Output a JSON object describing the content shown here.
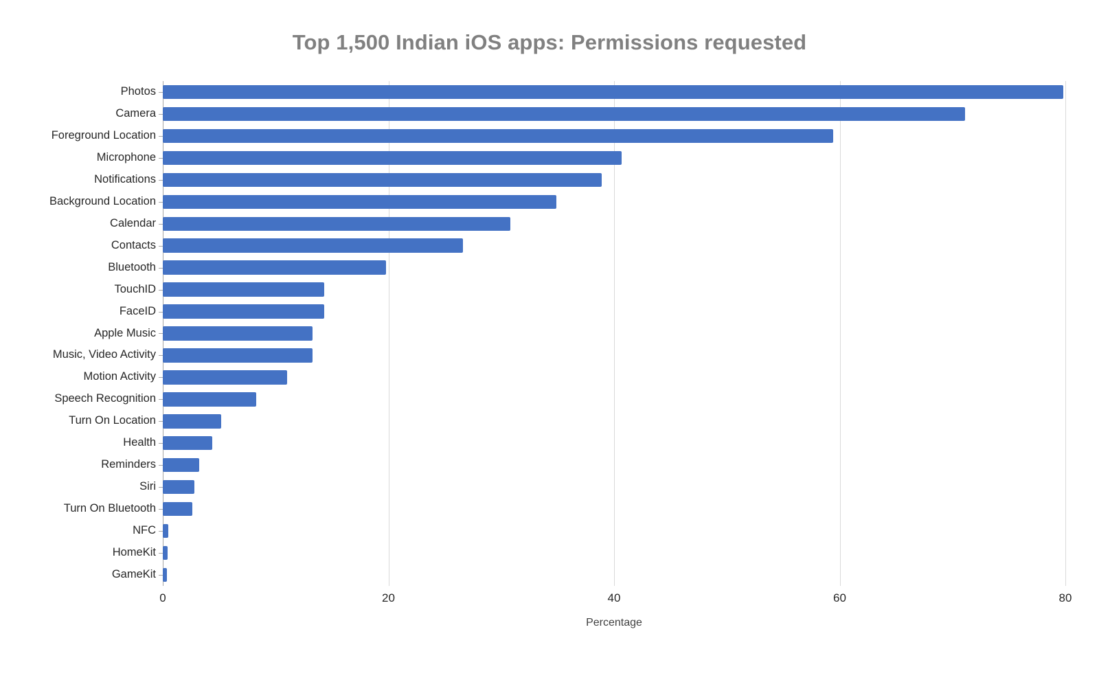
{
  "chart_data": {
    "type": "bar",
    "orientation": "horizontal",
    "title": "Top 1,500 Indian iOS apps: Permissions requested",
    "xlabel": "Percentage",
    "ylabel": "",
    "xlim": [
      0,
      80
    ],
    "xticks": [
      0,
      20,
      40,
      60,
      80
    ],
    "xtick_labels": [
      "0",
      "20",
      "40",
      "60",
      "80"
    ],
    "grid": true,
    "grid_axis": "x",
    "legend": false,
    "bar_color": "#4472c4",
    "title_color": "#808080",
    "gridline_color": "#d9d9d9",
    "categories": [
      "Photos",
      "Camera",
      "Foreground Location",
      "Microphone",
      "Notifications",
      "Background Location",
      "Calendar",
      "Contacts",
      "Bluetooth",
      "TouchID",
      "FaceID",
      "Apple Music",
      "Music, Video Activity",
      "Motion Activity",
      "Speech Recognition",
      "Turn On Location",
      "Health",
      "Reminders",
      "Siri",
      "Turn On Bluetooth",
      "NFC",
      "HomeKit",
      "GameKit"
    ],
    "values": [
      79.8,
      71.1,
      59.4,
      40.7,
      38.9,
      34.9,
      30.8,
      26.6,
      19.8,
      14.3,
      14.3,
      13.3,
      13.3,
      11.0,
      8.3,
      5.2,
      4.4,
      3.2,
      2.8,
      2.6,
      0.5,
      0.4,
      0.35
    ]
  }
}
